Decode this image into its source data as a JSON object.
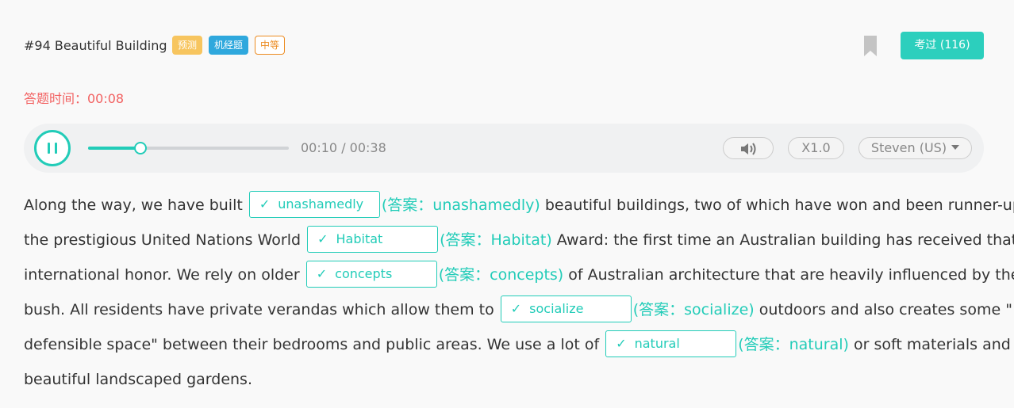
{
  "header": {
    "title": "#94 Beautiful Building",
    "tags": [
      "预测",
      "机经题",
      "中等"
    ],
    "exam_button": "考过 (116)"
  },
  "timer": {
    "label": "答题时间：00:08"
  },
  "player": {
    "progress": 0.26,
    "time": "00:10 / 00:38",
    "speed": "X1.0",
    "voice": "Steven (US)"
  },
  "passage": {
    "check": "✓",
    "segments": [
      "Along the way, we have built",
      "beautiful buildings, two of which have won and been runner-up in",
      "the prestigious United Nations World",
      "Award: the first time an Australian building has received that",
      "international honor. We rely on older",
      "of Australian architecture that are heavily influenced by the",
      "bush. All residents have private verandas which allow them to",
      "outdoors and also creates some \"",
      "defensible space\" between their bedrooms and public areas. We use a lot of",
      "or soft materials and build",
      "beautiful landscaped gardens."
    ],
    "blanks": [
      {
        "value": "unashamedly",
        "answer": "(答案：unashamedly)"
      },
      {
        "value": "Habitat",
        "answer": "(答案：Habitat)"
      },
      {
        "value": "concepts",
        "answer": "(答案：concepts)"
      },
      {
        "value": "socialize",
        "answer": "(答案：socialize)"
      },
      {
        "value": "natural",
        "answer": "(答案：natural)"
      }
    ]
  },
  "colors": {
    "accent": "#22ccb8",
    "timer": "#f26161",
    "tag_yellow": "#f7c55f",
    "tag_blue": "#2fa8dd",
    "tag_orange": "#ec8c22"
  },
  "icons": [
    "bookmark-icon",
    "pause-icon",
    "volume-icon",
    "caret-down-icon",
    "check-icon"
  ]
}
